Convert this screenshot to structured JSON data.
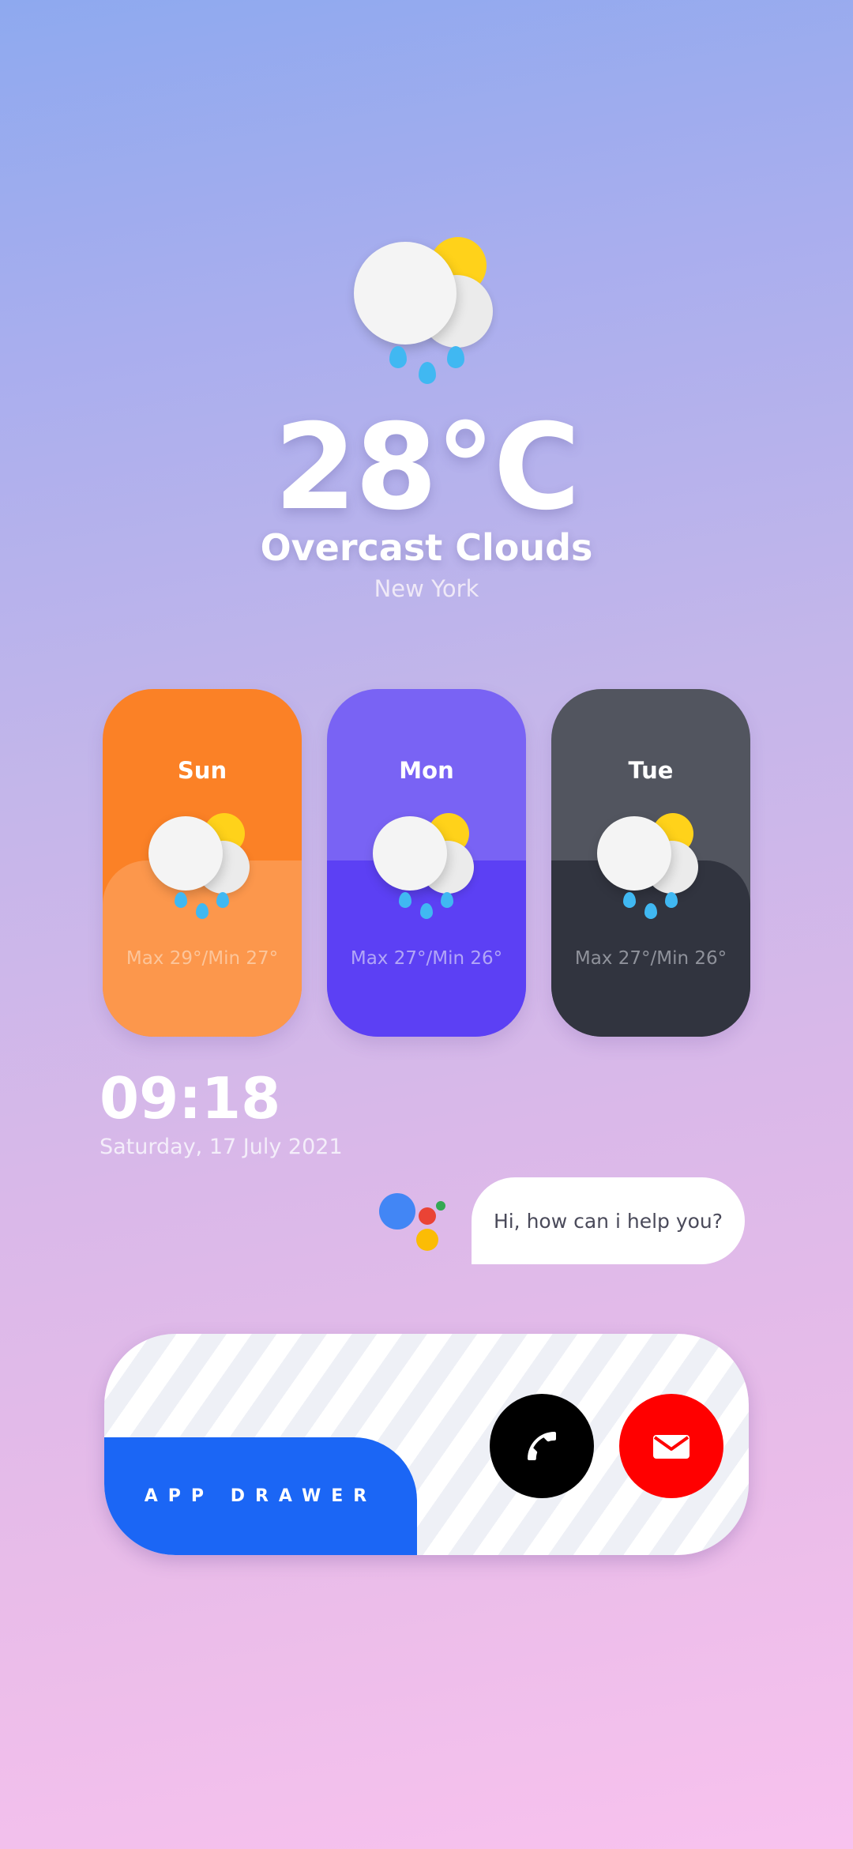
{
  "current": {
    "temperature": "28°C",
    "condition": "Overcast Clouds",
    "city": "New York",
    "icon": "rain-cloud-sun-icon"
  },
  "forecast": [
    {
      "day": "Sun",
      "range": "Max 29°/Min 27°",
      "icon": "rain-cloud-sun-icon",
      "top_color": "#fb8126",
      "bottom_color": "#fc974c",
      "text_color": "#fcc59a"
    },
    {
      "day": "Mon",
      "range": "Max 27°/Min 26°",
      "icon": "rain-cloud-sun-icon",
      "top_color": "#7963f4",
      "bottom_color": "#5c40f4",
      "text_color": "#b2a6f7"
    },
    {
      "day": "Tue",
      "range": "Max 27°/Min 26°",
      "icon": "rain-cloud-sun-icon",
      "top_color": "#52555f",
      "bottom_color": "#31343f",
      "text_color": "#8f929b"
    }
  ],
  "clock": {
    "time": "09:18",
    "date": "Saturday, 17 July 2021"
  },
  "assistant": {
    "icon": "google-assistant-icon",
    "message": "Hi, how can i help you?",
    "colors": [
      "#4286f5",
      "#ea4335",
      "#fbbc05",
      "#34a853"
    ]
  },
  "dock": {
    "app_drawer_label": "APP DRAWER",
    "phone_icon": "phone-icon",
    "mail_icon": "mail-icon",
    "phone_color": "#000000",
    "mail_color": "#ff0000"
  }
}
